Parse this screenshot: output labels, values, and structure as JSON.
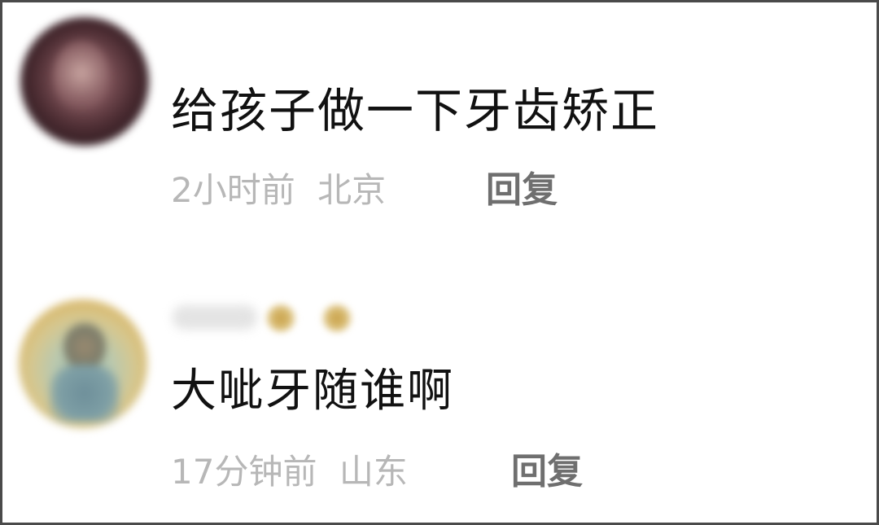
{
  "comments": [
    {
      "text": "给孩子做一下牙齿矫正",
      "time": "2小时前",
      "location": "北京",
      "reply_label": "回复"
    },
    {
      "text": "大呲牙随谁啊",
      "time": "17分钟前",
      "location": "山东",
      "reply_label": "回复"
    }
  ]
}
